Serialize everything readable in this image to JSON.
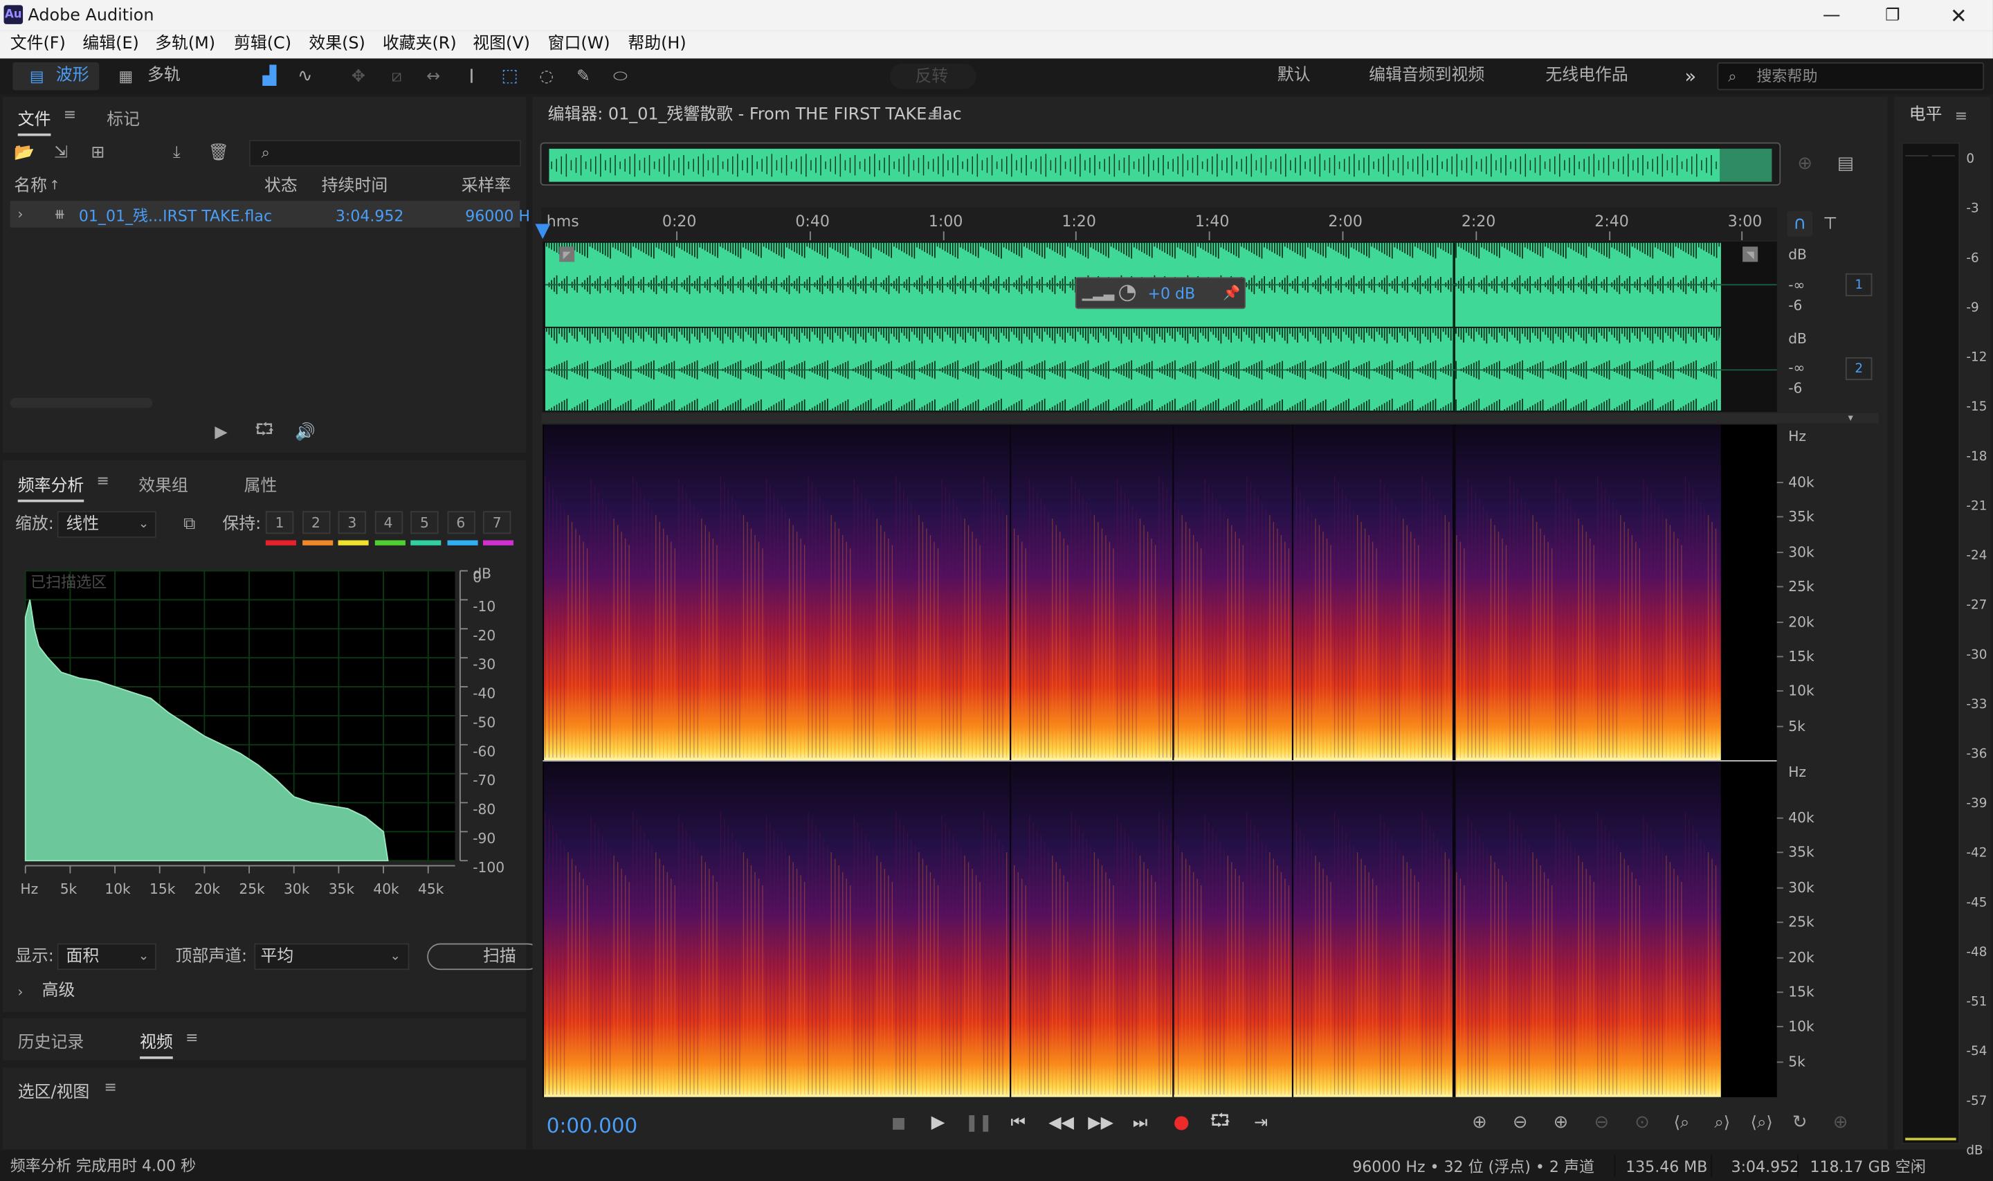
{
  "app": {
    "title": "Adobe Audition",
    "logo": "Au"
  },
  "menu": [
    "文件(F)",
    "编辑(E)",
    "多轨(M)",
    "剪辑(C)",
    "效果(S)",
    "收藏夹(R)",
    "视图(V)",
    "窗口(W)",
    "帮助(H)"
  ],
  "toolbar": {
    "waveform": "波形",
    "multitrack": "多轨",
    "reverse": "反转",
    "workspaces": [
      "默认",
      "编辑音频到视频",
      "无线电作品"
    ],
    "search_placeholder": "搜索帮助"
  },
  "files": {
    "tabs": [
      "文件",
      "标记"
    ],
    "columns": [
      "名称",
      "状态",
      "持续时间",
      "采样率"
    ],
    "rows": [
      {
        "name": "01_01_残...IRST TAKE.flac",
        "duration": "3:04.952",
        "rate": "96000 H"
      }
    ]
  },
  "freq": {
    "tabs": [
      "频率分析",
      "效果组",
      "属性"
    ],
    "zoom_label": "缩放:",
    "zoom_value": "线性",
    "hold_label": "保持:",
    "holds": [
      "1",
      "2",
      "3",
      "4",
      "5",
      "6",
      "7"
    ],
    "hold_colors": [
      "#e8202a",
      "#f0882a",
      "#f0e030",
      "#50d030",
      "#30d0a0",
      "#30b0f0",
      "#d030d0"
    ],
    "overlay": "已扫描选区",
    "db_unit": "dB",
    "db_ticks": [
      "0",
      "-10",
      "-20",
      "-30",
      "-40",
      "-50",
      "-60",
      "-70",
      "-80",
      "-90",
      "-100"
    ],
    "hz_ticks": [
      "Hz",
      "5k",
      "10k",
      "15k",
      "20k",
      "25k",
      "30k",
      "35k",
      "40k",
      "45k"
    ],
    "display_label": "显示:",
    "display_value": "面积",
    "channel_label": "顶部声道:",
    "channel_value": "平均",
    "scan": "扫描",
    "advanced": "高级"
  },
  "history": {
    "tabs": [
      "历史记录",
      "视频"
    ]
  },
  "selection": {
    "title": "选区/视图"
  },
  "editor": {
    "title": "编辑器: 01_01_残響散歌 - From THE FIRST TAKE.flac",
    "time_unit": "hms",
    "time_ticks": [
      "0:20",
      "0:40",
      "1:00",
      "1:20",
      "1:40",
      "2:00",
      "2:20",
      "2:40",
      "3:00"
    ],
    "hud_gain": "+0 dB",
    "db_label": "dB",
    "db_ticks": [
      "-∞",
      "-6"
    ],
    "channels": [
      "1",
      "2"
    ],
    "hz_label": "Hz",
    "hz_ticks": [
      "40k",
      "35k",
      "30k",
      "25k",
      "20k",
      "15k",
      "10k",
      "5k"
    ],
    "current_time": "0:00.000"
  },
  "level": {
    "title": "电平",
    "ticks": [
      "0",
      "-3",
      "-6",
      "-9",
      "-12",
      "-15",
      "-18",
      "-21",
      "-24",
      "-27",
      "-30",
      "-33",
      "-36",
      "-39",
      "-42",
      "-45",
      "-48",
      "-51",
      "-54",
      "-57",
      "dB"
    ]
  },
  "status": {
    "left": "频率分析 完成用时 4.00 秒",
    "format": "96000 Hz • 32 位 (浮点) • 2 声道",
    "size": "135.46 MB",
    "duration": "3:04.952",
    "free": "118.17 GB 空闲"
  },
  "chart_data": {
    "type": "area",
    "title": "",
    "xlabel": "Hz",
    "ylabel": "dB",
    "xlim": [
      0,
      48000
    ],
    "ylim": [
      -100,
      0
    ],
    "x": [
      0,
      500,
      1000,
      1500,
      2500,
      4000,
      6000,
      8000,
      10000,
      12000,
      14000,
      16000,
      18000,
      20000,
      22000,
      24000,
      26000,
      28000,
      30000,
      32000,
      34000,
      36000,
      38000,
      40000,
      40500
    ],
    "values": [
      -16,
      -10,
      -20,
      -26,
      -30,
      -35,
      -37,
      -38,
      -40,
      -42,
      -44,
      -49,
      -53,
      -57,
      -60,
      -63,
      -67,
      -72,
      -78,
      -80,
      -81,
      -82,
      -85,
      -90,
      -100
    ]
  }
}
